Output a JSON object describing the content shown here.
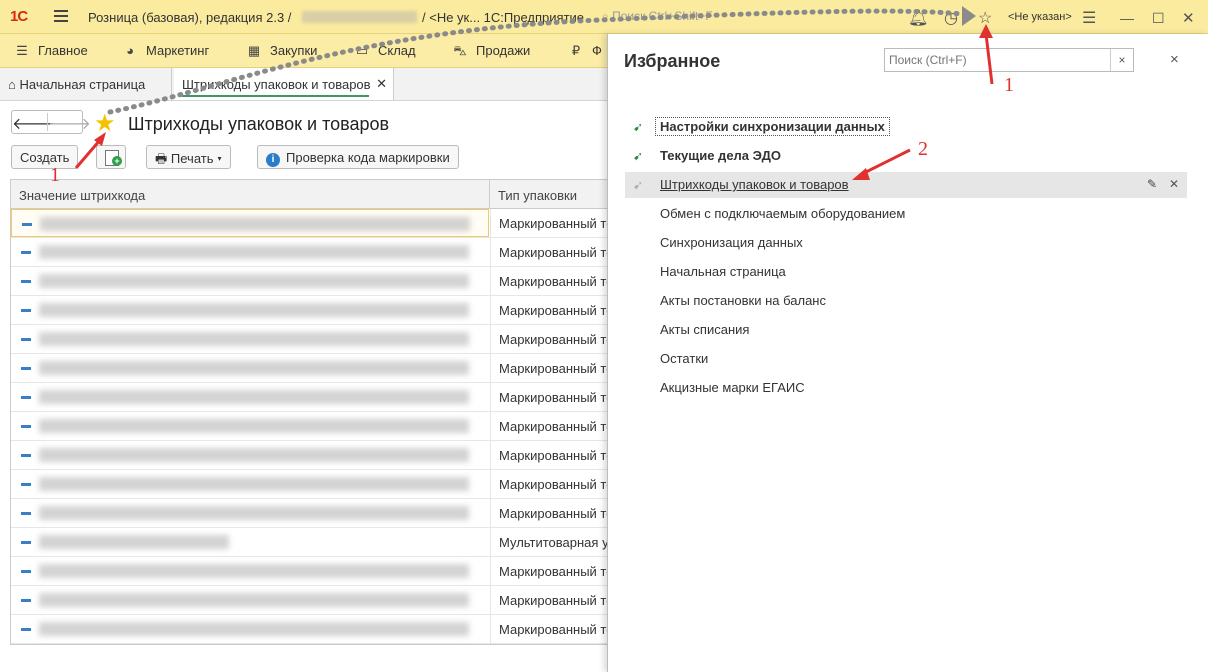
{
  "titlebar": {
    "logo": "1С",
    "app_title": "Розница (базовая), редакция 2.3 /",
    "app_title_rest": "/ <Не ук... 1С:Предприятие",
    "search_placeholder": "Поиск Ctrl+Shift+F",
    "user": "<Не указан>"
  },
  "sections": [
    {
      "label": "Главное",
      "icon": "menu-icon"
    },
    {
      "label": "Маркетинг",
      "icon": "pie-chart-icon"
    },
    {
      "label": "Закупки",
      "icon": "grid-icon"
    },
    {
      "label": "Склад",
      "icon": "warehouse-icon"
    },
    {
      "label": "Продажи",
      "icon": "basket-icon"
    },
    {
      "label": "Ф",
      "icon": "ruble-icon"
    }
  ],
  "tabs": {
    "home": "Начальная страница",
    "active": "Штрихкоды упаковок и товаров"
  },
  "form": {
    "title": "Штрихкоды упаковок и товаров",
    "create_label": "Создать",
    "print_label": "Печать",
    "check_label": "Проверка кода маркировки"
  },
  "grid": {
    "columns": [
      "Значение штрихкода",
      "Тип упаковки"
    ],
    "rows": [
      "Маркированный то",
      "Маркированный то",
      "Маркированный то",
      "Маркированный то",
      "Маркированный то",
      "Маркированный то",
      "Маркированный то",
      "Маркированный то",
      "Маркированный то",
      "Маркированный то",
      "Маркированный то",
      "Мультитоварная у",
      "Маркированный то",
      "Маркированный то",
      "Маркированный то"
    ]
  },
  "favorites": {
    "title": "Избранное",
    "search_placeholder": "Поиск (Ctrl+F)",
    "clear": "×",
    "close": "×",
    "items": [
      {
        "label": "Настройки синхронизации данных",
        "bold": true
      },
      {
        "label": "Текущие дела ЭДО",
        "bold": true
      },
      {
        "label": "Штрихкоды упаковок и товаров",
        "bold": false
      },
      {
        "label": "Обмен с подключаемым оборудованием",
        "bold": false
      },
      {
        "label": "Синхронизация данных",
        "bold": false
      },
      {
        "label": "Начальная страница",
        "bold": false
      },
      {
        "label": "Акты постановки на баланс",
        "bold": false
      },
      {
        "label": "Акты списания",
        "bold": false
      },
      {
        "label": "Остатки",
        "bold": false
      },
      {
        "label": "Акцизные марки ЕГАИС",
        "bold": false
      }
    ]
  },
  "annotations": [
    "1",
    "1",
    "2"
  ],
  "colors": {
    "titlebar": "#fbeb9f",
    "accent_green": "#3a9a63",
    "annotation_red": "#e03030"
  }
}
